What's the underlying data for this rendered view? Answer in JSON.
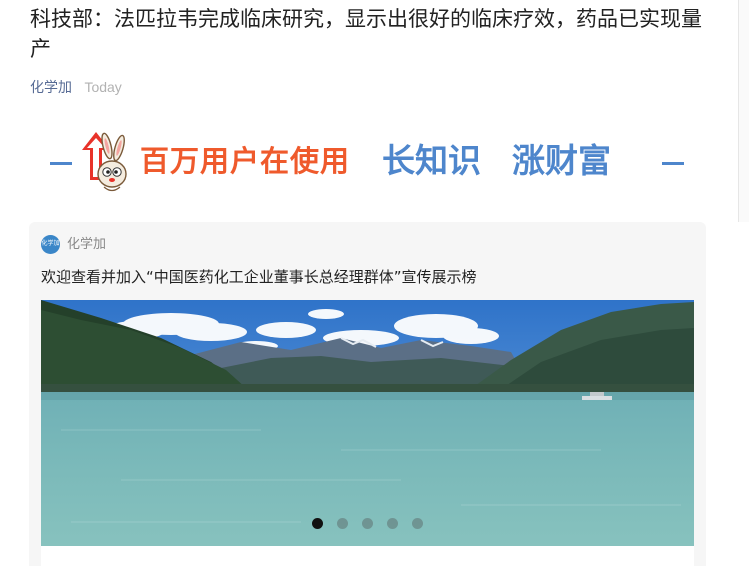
{
  "article": {
    "title": "科技部：法匹拉韦完成临床研究，显示出很好的临床疗效，药品已实现量产",
    "account": "化学加",
    "date": "Today"
  },
  "banner": {
    "slogan_red": "百万用户在使用",
    "slogan_blue_1": "长知识",
    "slogan_blue_2": "涨财富",
    "brand_color_red": "#ef5a2c",
    "brand_color_blue": "#4e86cc"
  },
  "card": {
    "source_name": "化学加",
    "avatar_text": "化学加",
    "title": "欢迎查看并加入“中国医药化工企业董事长总经理群体”宣传展示榜",
    "carousel": {
      "slide_count": 5,
      "active_index": 0
    }
  }
}
